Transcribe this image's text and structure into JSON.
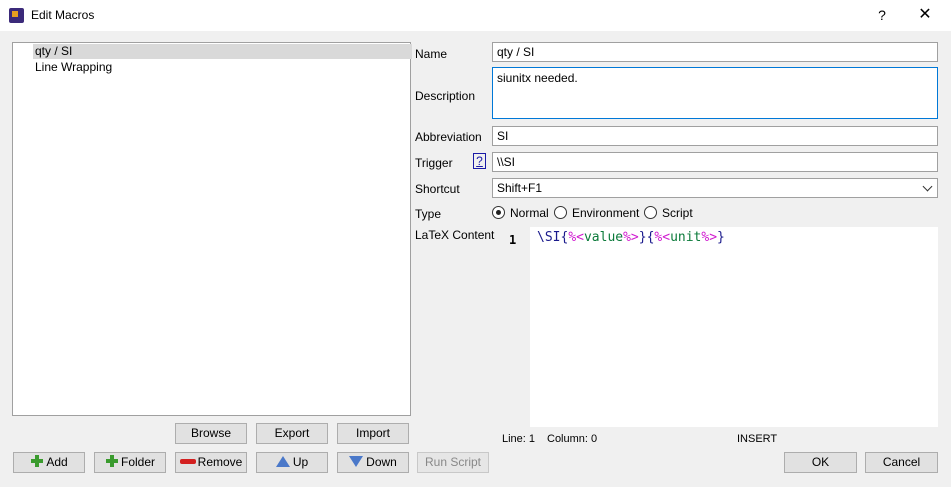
{
  "window": {
    "title": "Edit Macros",
    "help": "?",
    "close": "✕"
  },
  "tree": {
    "items": [
      "qty / SI",
      "Line Wrapping"
    ]
  },
  "buttons": {
    "browse": "Browse",
    "export": "Export",
    "import": "Import",
    "add": "Add",
    "folder": "Folder",
    "remove": "Remove",
    "up": "Up",
    "down": "Down",
    "run_script": "Run Script",
    "ok": "OK",
    "cancel": "Cancel"
  },
  "form": {
    "name_label": "Name",
    "name_value": "qty / SI",
    "description_label": "Description",
    "description_value": "siunitx needed.",
    "abbreviation_label": "Abbreviation",
    "abbreviation_value": "SI",
    "trigger_label": "Trigger",
    "trigger_help": "?",
    "trigger_value": "\\\\SI",
    "shortcut_label": "Shortcut",
    "shortcut_value": "Shift+F1",
    "type_label": "Type",
    "type_options": [
      "Normal",
      "Environment",
      "Script"
    ],
    "type_selected": "Normal",
    "latex_label": "LaTeX Content"
  },
  "editor": {
    "line_number": "1",
    "code": {
      "cmd": "\\SI",
      "open1": "{",
      "ph_open1": "%<",
      "val1": "value",
      "ph_close1": "%>",
      "close1": "}",
      "open2": "{",
      "ph_open2": "%<",
      "val2": "unit",
      "ph_close2": "%>",
      "close2": "}"
    }
  },
  "status": {
    "line": "Line: 1",
    "column": "Column: 0",
    "mode": "INSERT"
  }
}
